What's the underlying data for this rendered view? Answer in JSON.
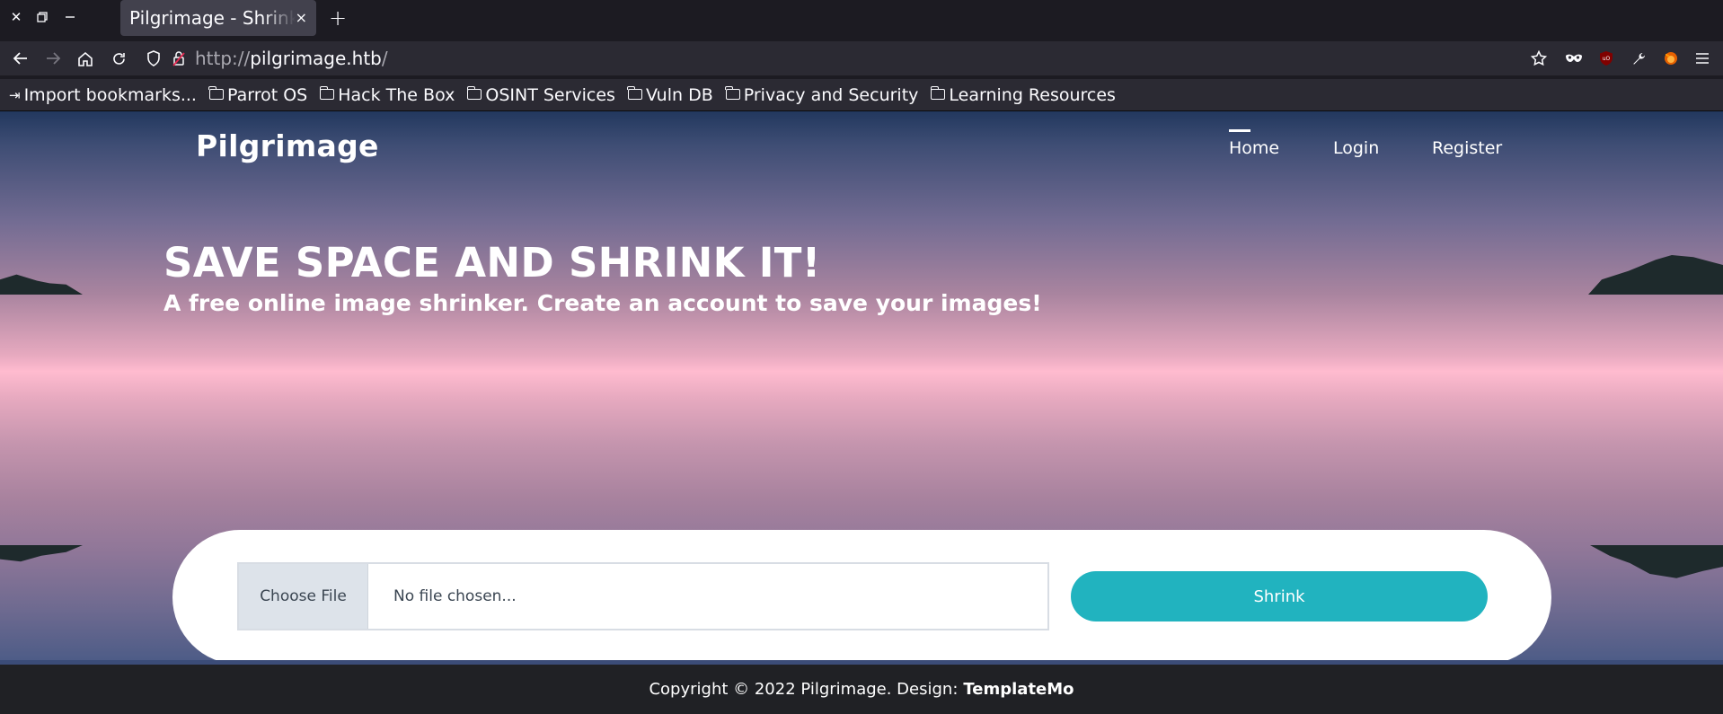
{
  "browser": {
    "tab_title": "Pilgrimage - Shrink Your Images",
    "tab_close": "×",
    "new_tab": "+",
    "url_protocol": "http://",
    "url_host": "pilgrimage.htb",
    "url_path": "/",
    "icons": [
      "back-icon",
      "forward-icon",
      "home-icon",
      "reload-icon",
      "shield-icon",
      "lock-icon",
      "star-icon",
      "mask-icon",
      "ublock-icon",
      "wrench-icon",
      "firefox-icon",
      "hamburger-menu-icon"
    ]
  },
  "bookmarks": [
    {
      "label": "Import bookmarks...",
      "kind": "import"
    },
    {
      "label": "Parrot OS",
      "kind": "folder"
    },
    {
      "label": "Hack The Box",
      "kind": "folder"
    },
    {
      "label": "OSINT Services",
      "kind": "folder"
    },
    {
      "label": "Vuln DB",
      "kind": "folder"
    },
    {
      "label": "Privacy and Security",
      "kind": "folder"
    },
    {
      "label": "Learning Resources",
      "kind": "folder"
    }
  ],
  "site": {
    "brand": "Pilgrimage",
    "nav": {
      "home": "Home",
      "login": "Login",
      "register": "Register",
      "active": "Home"
    },
    "hero_title": "SAVE SPACE AND SHRINK IT!",
    "hero_subtitle": "A free online image shrinker. Create an account to save your images!",
    "upload": {
      "choose_label": "Choose File",
      "no_file": "No file chosen...",
      "submit": "Shrink"
    },
    "footer": {
      "text": "Copyright © 2022 Pilgrimage. Design:",
      "link": "TemplateMo"
    }
  },
  "colors": {
    "accent": "#21b3bf",
    "sky_top": "#22385e",
    "horizon": "#ffbbcf"
  }
}
